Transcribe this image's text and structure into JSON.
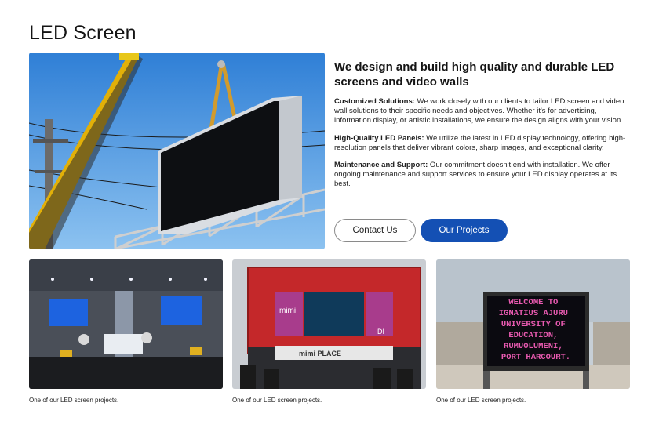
{
  "page": {
    "title": "LED Screen"
  },
  "intro": {
    "headline": "We design and build high quality and durable LED screens and video walls",
    "features": [
      {
        "label": "Customized Solutions:",
        "text": " We work closely with our clients to tailor LED screen and video wall solutions to their specific needs and objectives. Whether it's for advertising, information display, or artistic installations, we ensure the design aligns with your vision."
      },
      {
        "label": "High-Quality LED Panels:",
        "text": " We utilize the latest in LED display technology, offering high-resolution panels that deliver vibrant colors, sharp images, and exceptional clarity."
      },
      {
        "label": "Maintenance and Support:",
        "text": " Our commitment doesn't end with installation. We offer ongoing maintenance and support services to ensure your LED display operates at its best."
      }
    ]
  },
  "buttons": {
    "contact": "Contact Us",
    "projects": "Our Projects"
  },
  "gallery": [
    {
      "caption": "One of our LED screen projects."
    },
    {
      "caption": "One of our LED screen projects.",
      "screen_text": "mimi",
      "stage_text": "mimi PLACE",
      "sign": "DI"
    },
    {
      "caption": "One of our LED screen projects.",
      "screen_lines": [
        "WELCOME TO",
        "IGNATIUS AJURU",
        "UNIVERSITY OF",
        "EDUCATION,",
        "RUMUOLUMENI,",
        "PORT HARCOURT."
      ]
    }
  ],
  "colors": {
    "accent": "#1450b4",
    "led_text": "#e85ab0",
    "sky": "#3f8fe0"
  }
}
